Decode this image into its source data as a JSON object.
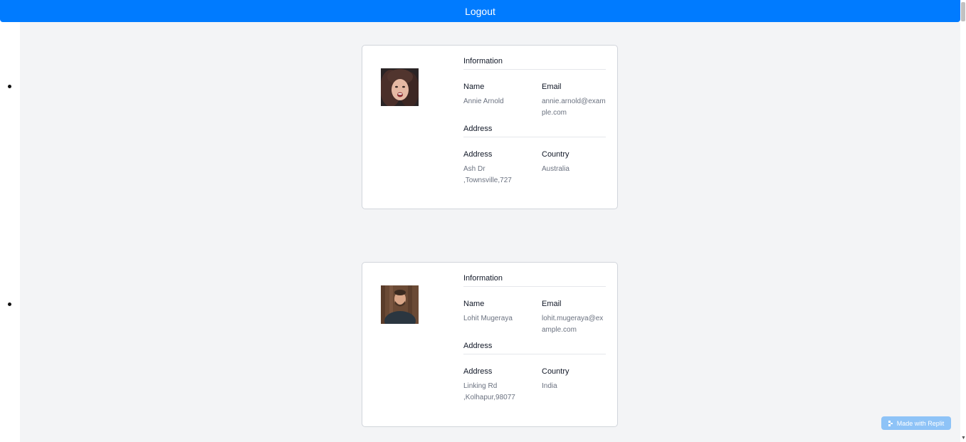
{
  "topbar": {
    "logout_label": "Logout"
  },
  "users": [
    {
      "section_info": "Information",
      "name_label": "Name",
      "name": "Annie Arnold",
      "email_label": "Email",
      "email": "annie.arnold@example.com",
      "section_address": "Address",
      "address_label": "Address",
      "address": "Ash Dr ,Townsville,727",
      "country_label": "Country",
      "country": "Australia"
    },
    {
      "section_info": "Information",
      "name_label": "Name",
      "name": "Lohit Mugeraya",
      "email_label": "Email",
      "email": "lohit.mugeraya@example.com",
      "section_address": "Address",
      "address_label": "Address",
      "address": "Linking Rd ,Kolhapur,98077",
      "country_label": "Country",
      "country": "India"
    }
  ],
  "badge": {
    "label": "Made with Replit",
    "icon": "replit-icon"
  },
  "colors": {
    "topbar": "#007bff",
    "page_bg": "#f3f4f6",
    "card_border": "#d1d5db",
    "badge_bg": "#8ec3f7"
  }
}
